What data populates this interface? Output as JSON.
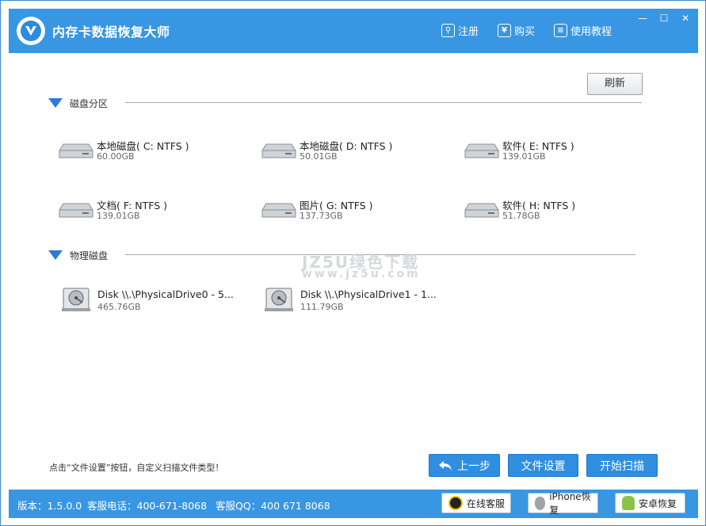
{
  "app": {
    "title": "内存卡数据恢复大师",
    "links": [
      {
        "label": "注册",
        "icon": "search-key-icon"
      },
      {
        "label": "购买",
        "icon": "yen-icon"
      },
      {
        "label": "使用教程",
        "icon": "document-icon"
      }
    ],
    "window_controls": [
      {
        "glyph": "—",
        "icon": "minimize-icon"
      },
      {
        "glyph": "☐",
        "icon": "maximize-icon"
      },
      {
        "glyph": "✕",
        "icon": "close-icon"
      }
    ]
  },
  "toolbar": {
    "refresh_label": "刷新"
  },
  "partitions": {
    "label": "磁盘分区",
    "items": [
      {
        "name": "本地磁盘( C: NTFS )",
        "size": "60.00GB"
      },
      {
        "name": "本地磁盘( D: NTFS )",
        "size": "50.01GB"
      },
      {
        "name": "软件( E: NTFS )",
        "size": "139.01GB"
      },
      {
        "name": "文档( F: NTFS )",
        "size": "139.01GB"
      },
      {
        "name": "图片( G: NTFS )",
        "size": "137.73GB"
      },
      {
        "name": "软件( H: NTFS )",
        "size": "51.78GB"
      }
    ]
  },
  "physical": {
    "label": "物理磁盘",
    "items": [
      {
        "name": "Disk \\\\.\\PhysicalDrive0 - 5...",
        "size": "465.76GB"
      },
      {
        "name": "Disk \\\\.\\PhysicalDrive1 - 1...",
        "size": "111.79GB"
      }
    ]
  },
  "watermark": {
    "text": "JZ5U绿色下载",
    "url": "www.jz5u.com"
  },
  "footer": {
    "hint": "点击“文件设置”按钮，自定义扫描文件类型！",
    "back_label": "上一步",
    "settings_label": "文件设置",
    "scan_label": "开始扫描"
  },
  "status": {
    "version": "版本：1.5.0.0",
    "phone": "客服电话：400-671-8068",
    "qq": "客服QQ：400 671 8068",
    "online_label": "在线客服",
    "iphone_label": "iPhone恢复",
    "android_label": "安卓恢复"
  },
  "colors": {
    "accent": "#3896e3",
    "button": "#2f8ee0"
  }
}
